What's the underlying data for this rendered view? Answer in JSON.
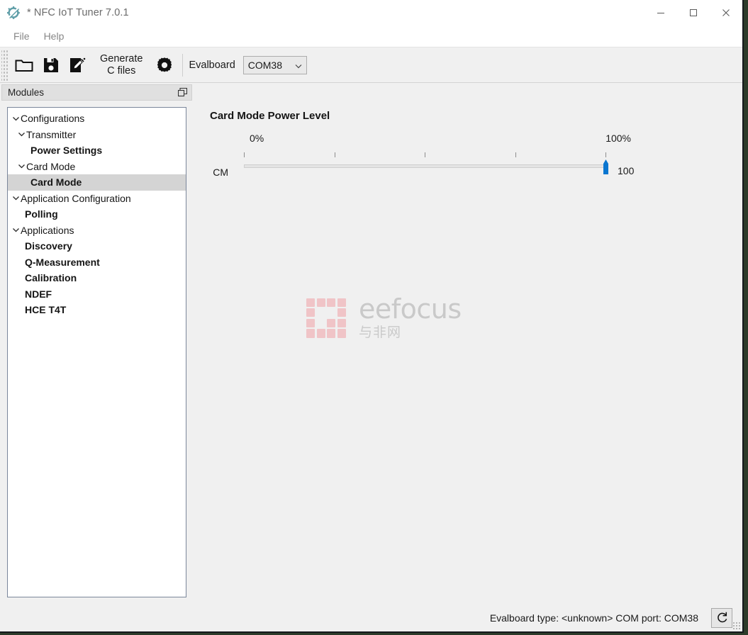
{
  "window": {
    "title": "* NFC IoT Tuner 7.0.1",
    "app_icon": "nfc-tuner-logo-icon",
    "controls": {
      "minimize": "minimize-icon",
      "maximize": "maximize-icon",
      "close": "close-icon"
    }
  },
  "menubar": {
    "items": [
      {
        "label": "File"
      },
      {
        "label": "Help"
      }
    ]
  },
  "toolbar": {
    "open_icon": "folder-open-icon",
    "save_icon": "floppy-save-icon",
    "edit_icon": "edit-document-icon",
    "generate_label_line1": "Generate",
    "generate_label_line2": "C files",
    "settings_icon": "gear-icon",
    "evalboard_label": "Evalboard",
    "port_combo": {
      "value": "COM38",
      "chevron": "chevron-down-icon"
    }
  },
  "dock": {
    "title": "Modules",
    "float_icon": "float-window-icon",
    "tree": [
      {
        "label": "Configurations",
        "level": 1,
        "expandable": true,
        "expanded": true,
        "selected": false,
        "bold": false
      },
      {
        "label": "Transmitter",
        "level": 2,
        "expandable": true,
        "expanded": true,
        "selected": false,
        "bold": false
      },
      {
        "label": "Power Settings",
        "level": 3,
        "expandable": false,
        "expanded": false,
        "selected": false,
        "bold": true
      },
      {
        "label": "Card Mode",
        "level": 2,
        "expandable": true,
        "expanded": true,
        "selected": false,
        "bold": false
      },
      {
        "label": "Card Mode",
        "level": 3,
        "expandable": false,
        "expanded": false,
        "selected": true,
        "bold": true
      },
      {
        "label": "Application Configuration",
        "level": 1,
        "expandable": true,
        "expanded": true,
        "selected": false,
        "bold": false
      },
      {
        "label": "Polling",
        "level": 2,
        "expandable": false,
        "expanded": false,
        "selected": false,
        "bold": true
      },
      {
        "label": "Applications",
        "level": 1,
        "expandable": true,
        "expanded": true,
        "selected": false,
        "bold": false
      },
      {
        "label": "Discovery",
        "level": 2,
        "expandable": false,
        "expanded": false,
        "selected": false,
        "bold": true
      },
      {
        "label": "Q-Measurement",
        "level": 2,
        "expandable": false,
        "expanded": false,
        "selected": false,
        "bold": true
      },
      {
        "label": "Calibration",
        "level": 2,
        "expandable": false,
        "expanded": false,
        "selected": false,
        "bold": true
      },
      {
        "label": "NDEF",
        "level": 2,
        "expandable": false,
        "expanded": false,
        "selected": false,
        "bold": true
      },
      {
        "label": "HCE T4T",
        "level": 2,
        "expandable": false,
        "expanded": false,
        "selected": false,
        "bold": true
      }
    ]
  },
  "main": {
    "panel_title": "Card Mode Power Level",
    "slider": {
      "name": "CM",
      "scale_min_label": "0%",
      "scale_max_label": "100%",
      "value": "100",
      "min": 0,
      "max": 100,
      "tick_percents": [
        0,
        25,
        50,
        75,
        100
      ],
      "thumb_color": "#0a76d0",
      "track_color": "#e4e4e4"
    },
    "watermark": {
      "main_text": "eefocus",
      "sub_text": "与非网",
      "mark_color": "#f0c4c7",
      "text_color": "#c9c9c9"
    }
  },
  "statusbar": {
    "evalboard_type_label": "Evalboard type:",
    "evalboard_type_value": "<unknown>",
    "com_port_label": "COM port:",
    "com_port_value": "COM38",
    "refresh_icon": "refresh-icon"
  }
}
